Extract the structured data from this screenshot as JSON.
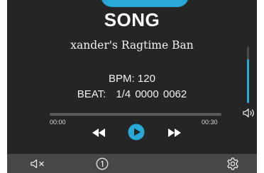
{
  "header": {
    "title": "SONG"
  },
  "song": {
    "name": "xander's Ragtime Ban",
    "bpm_label": "BPM:",
    "bpm_value": "120",
    "beat_label": "BEAT:",
    "beat_value": "1/4 0000 0062"
  },
  "playback": {
    "time_elapsed": "00:00",
    "time_total": "00:30",
    "progress_fraction": 0.0,
    "volume_fraction": 0.78
  },
  "controls": {
    "rewind_icon": "rewind-icon",
    "play_icon": "play-icon",
    "fast_forward_icon": "fast-forward-icon",
    "volume_icon": "speaker-icon"
  },
  "bottom_bar": {
    "icons": [
      "mute-icon",
      "info-icon",
      "gear-icon"
    ]
  },
  "colors": {
    "accent": "#29a9d8",
    "background": "#252525",
    "bottom_bar": "#474747"
  }
}
